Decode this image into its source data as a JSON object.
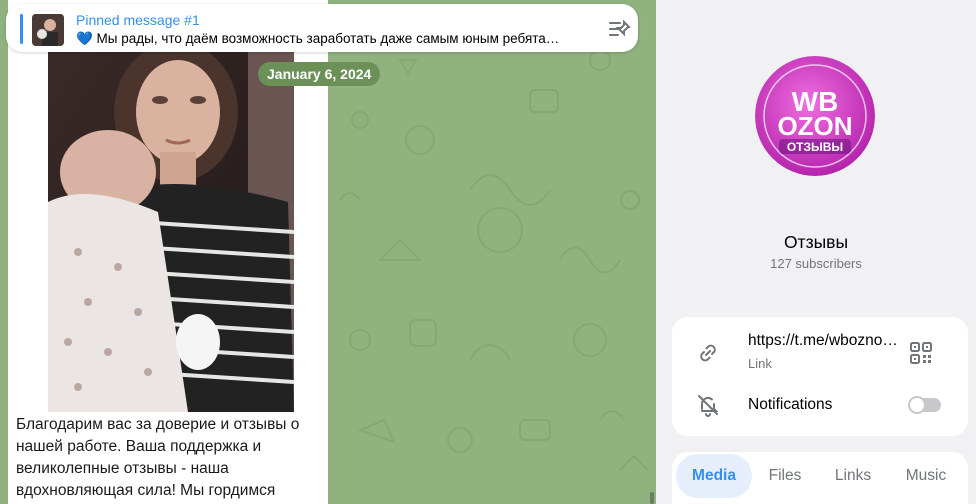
{
  "pinned": {
    "title": "Pinned message #1",
    "text": "💙 Мы рады, что даём возможность заработать даже самым юным ребята…",
    "icon": "unpin-list-icon"
  },
  "date_label": "January 6, 2024",
  "message": {
    "text": "Благодарим вас за доверие и отзывы о нашей работе. Ваша поддержка и великолепные отзывы - наша вдохновляющая сила! Мы гордимся"
  },
  "profile": {
    "avatar": {
      "line1": "WB",
      "line2": "OZON",
      "line3": "ОТЗЫВЫ",
      "accent": "#d63cc8"
    },
    "name": "Отзывы",
    "subscribers": "127 subscribers",
    "link": {
      "value": "https://t.me/wboznotzivi",
      "label": "Link",
      "icon": "link-icon",
      "qr_icon": "qr-code-icon"
    },
    "notifications": {
      "label": "Notifications",
      "icon": "bell-off-icon",
      "enabled": false
    }
  },
  "tabs": [
    {
      "label": "Media",
      "active": true
    },
    {
      "label": "Files",
      "active": false
    },
    {
      "label": "Links",
      "active": false
    },
    {
      "label": "Music",
      "active": false
    }
  ],
  "colors": {
    "accent": "#3390ec",
    "chat_background": "#8fb27f",
    "date_pill": "#6c9158"
  }
}
